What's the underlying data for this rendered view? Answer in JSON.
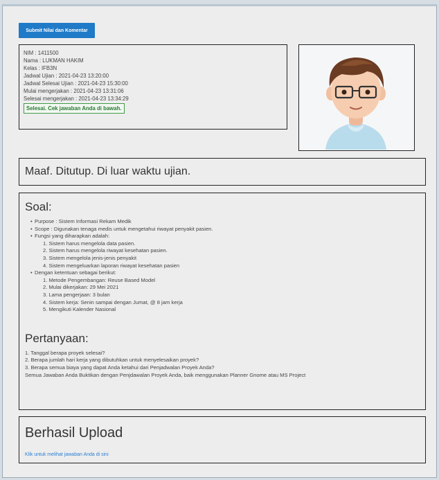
{
  "submit_button": "Submit Nilai dan Komentar",
  "info": {
    "lines": [
      "NIM : 1411500",
      "Nama : LUKMAN HAKIM",
      "Kelas : IFB3N",
      "Jadwal Ujian : 2021-04-23 13:20:00",
      "Jadwal Selesai Ujian : 2021-04-23 15:30:00",
      "Mulai mengerjakan : 2021-04-23 13:31:06",
      "Selesai mengerjakan : 2021-04-23 13:34:29"
    ],
    "status": "Selesai. Cek jawaban Anda di bawah."
  },
  "message": "Maaf. Ditutup. Di luar waktu ujian.",
  "soal": {
    "heading": "Soal:",
    "purpose": "Purpose : Sistem Informasi Rekam Medik",
    "scope": "Scope : Digunakan tenaga medis untuk mengetahui riwayat penyakit pasien.",
    "fungsi_label": "Fungsi yang diharapkan adalah:",
    "fungsi": [
      "1. Sistem harus mengelola data pasien.",
      "2. Sistem harus mengelola riwayat kesehatan pasien.",
      "3. Sistem mengelola jenis-jenis penyakit",
      "4. Sistem mengeluarkan laporan riwayat kesehatan pasien"
    ],
    "ketentuan_label": "Dengan ketentuan sebagai berikut:",
    "ketentuan": [
      "1. Metode Pengembangan: Reuse Based Model",
      "2. Mulai dikerjakan: 29 Mei 2021",
      "3. Lama pengerjaan: 3 bulan",
      "4. Sistem kerja: Senin sampai dengan Jumat, @ 8 jam kerja",
      "5. Mengikuti Kalender Nasional"
    ]
  },
  "pertanyaan": {
    "heading": "Pertanyaan:",
    "items": [
      "1. Tanggal berapa proyek selesai?",
      "2. Berapa jumlah hari kerja yang dibutuhkan untuk menyelesaikan proyek?",
      "3. Berapa semua biaya yang dapat Anda ketahui dari Penjadwalan Proyek Anda?",
      "Semua Jawaban Anda Buktikan dengan Penjdawalan Proyek Anda, baik menggunakan Planner Gnome atau MS Project"
    ]
  },
  "upload": {
    "title": "Berhasil Upload",
    "link": "Klik untuk melihat jawaban Anda di sini"
  },
  "icons": {
    "avatar": "user-avatar-3d"
  }
}
